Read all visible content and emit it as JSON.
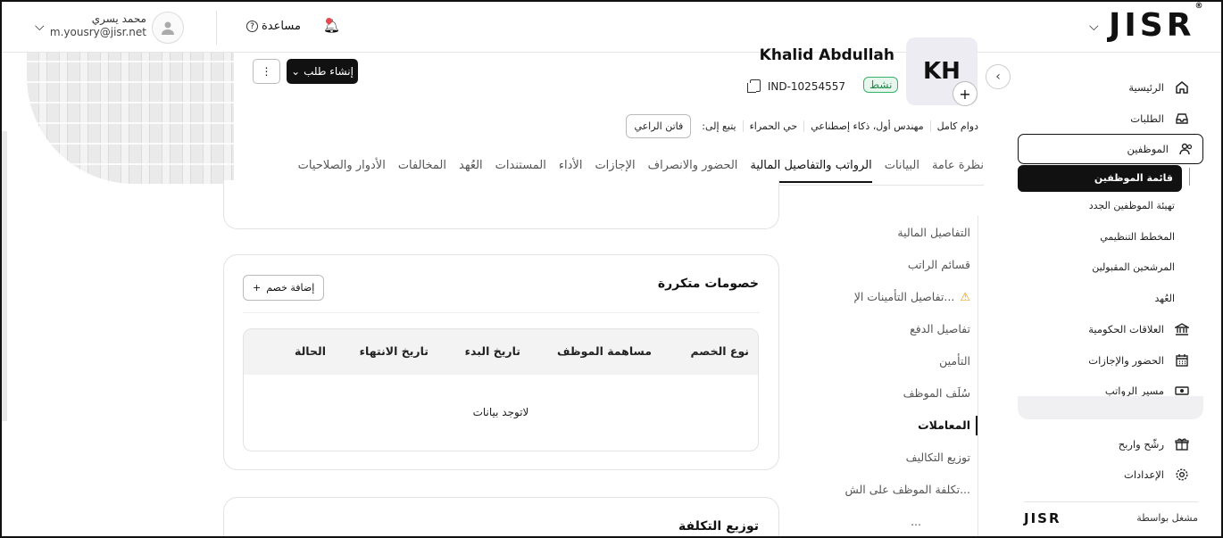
{
  "header": {
    "logo": "JISR",
    "help_label": "مساعدة",
    "user": {
      "name": "محمد يسري",
      "email": "m.yousry@jisr.net"
    }
  },
  "employee": {
    "initials": "KH",
    "name": "Khalid Abdullah",
    "status": "نشط",
    "id": "IND-10254557",
    "create_request": "إنشاء طلب",
    "meta": [
      "دوام كامل",
      "مهندس أول، ذكاء إصطناعي",
      "حي الحمراء"
    ],
    "reports_to_label": "يتبع إلى:",
    "manager": "فاتن الراعي"
  },
  "tabs": [
    {
      "label": "نظرة عامة",
      "active": false
    },
    {
      "label": "البيانات",
      "active": false
    },
    {
      "label": "الرواتب والتفاصيل المالية",
      "active": true
    },
    {
      "label": "الحضور والانصراف",
      "active": false
    },
    {
      "label": "الإجازات",
      "active": false
    },
    {
      "label": "الأداء",
      "active": false
    },
    {
      "label": "المستندات",
      "active": false
    },
    {
      "label": "العُهد",
      "active": false
    },
    {
      "label": "المخالفات",
      "active": false
    },
    {
      "label": "الأدوار والصلاحيات",
      "active": false
    }
  ],
  "sidebar": {
    "items": [
      {
        "label": "الرئيسية",
        "icon": "home-icon"
      },
      {
        "label": "الطلبات",
        "icon": "inbox-icon"
      },
      {
        "label": "الموظفين",
        "icon": "users-icon"
      },
      {
        "label": "العلاقات الحكومية",
        "icon": "bank-icon"
      },
      {
        "label": "الحضور والإجازات",
        "icon": "calendar-icon"
      },
      {
        "label": "مسير الرواتب",
        "icon": "money-icon"
      },
      {
        "label": "رشّح واربح",
        "icon": "gift-icon"
      },
      {
        "label": "الإعدادات",
        "icon": "gear-icon"
      }
    ],
    "sub_items": [
      "قائمة الموظفين",
      "تهيئة الموظفين الجدد",
      "المخطط التنظيمي",
      "المرشحين المقبولين",
      "العُهد"
    ],
    "powered_by": "مشغل بواسطة",
    "powered_logo": "JISR"
  },
  "section_nav": [
    "التفاصيل المالية",
    "قسائم الراتب",
    "تفاصيل التأمينات الإ...",
    "تفاصيل الدفع",
    "التأمين",
    "سُلَف الموظف",
    "المعاملات",
    "توزيع التكاليف",
    "تكلفة الموظف على الش...",
    "..."
  ],
  "deductions": {
    "title": "خصومات متكررة",
    "add_button": "إضافة خصم",
    "columns": [
      "نوع الخصم",
      "مساهمة الموظف",
      "تاريخ البدء",
      "تاريخ الانتهاء",
      "الحالة"
    ],
    "empty": "لاتوجد بيانات"
  },
  "cost": {
    "title": "توزيع التكلفة"
  }
}
